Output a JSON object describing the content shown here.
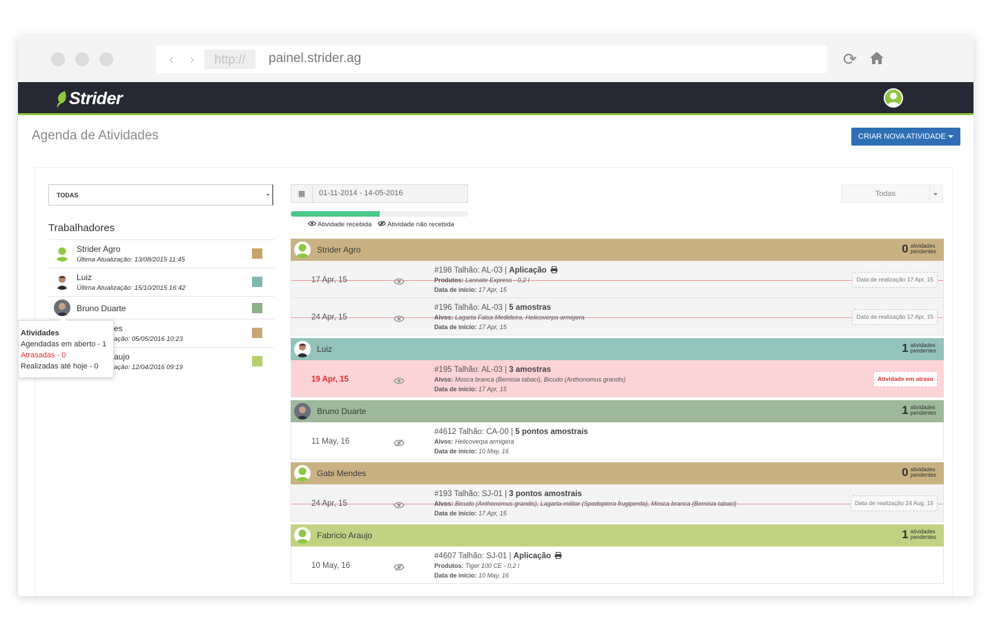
{
  "browser": {
    "protocol": "http://",
    "host": "painel.strider.ag",
    "nav_glyphs": "‹ ›",
    "reload_glyph": "⟳"
  },
  "app": {
    "brand": "Strider",
    "brand_color": "#8dc63f",
    "page_title": "Agenda de Atividades",
    "create_button": "CRIAR NOVA ATIVIDADE"
  },
  "sidebar": {
    "filter_value": "TODAS",
    "workers_title": "Trabalhadores",
    "workers": [
      {
        "name": "Strider Agro",
        "update": "Última Atualização: 13/08/2015 11:45",
        "color": "#c7a46a"
      },
      {
        "name": "Luiz",
        "update": "Última Atualização: 15/10/2015 16:42",
        "color": "#7fb8b0"
      },
      {
        "name": "Bruno Duarte",
        "update": "",
        "color": "#8fae8a"
      },
      {
        "name": "es",
        "update": "ação: 05/05/2016 10:23",
        "color": "#c9a57a"
      },
      {
        "name": "aujo",
        "update": "ação: 12/04/2016 09:19",
        "color": "#b5cf6b"
      }
    ],
    "tooltip": {
      "title": "Atividades",
      "line1": "Agendadas em aberto - 1",
      "line2": "Atrasadas - 0",
      "line3": "Realizadas até hoje - 0"
    }
  },
  "toolbar": {
    "calendar_glyph": "▦",
    "date_range": "01-11-2014 - 14-05-2016",
    "progress": 0.5,
    "legend_received": "Atividade recebida",
    "legend_not_received": "Atividade não recebida",
    "status_filter": "Todas"
  },
  "pending_label_1": "atividades",
  "pending_label_2": "pendentes",
  "groups": [
    {
      "name": "Strider Agro",
      "count": "0",
      "color": "#c9b183",
      "activities": [
        {
          "date": "17 Apr, 15",
          "title": "#198 Talhão: AL-03 |",
          "type": "Aplicação",
          "print": true,
          "l2_label": "Produtos:",
          "l2_value": "Lannate Express - 0,2 l",
          "l3_label": "Data de início:",
          "l3_value": "17 Apr, 15",
          "status": "Data de realização 17 Apr, 15",
          "style": "gray",
          "struck": true
        },
        {
          "date": "24 Apr, 15",
          "title": "#196 Talhão: AL-03 |",
          "type": "5 amostras",
          "print": false,
          "l2_label": "Alvos:",
          "l2_value": "Lagarta Falsa Medideira, Helicoverpa armigera",
          "l3_label": "Data de início:",
          "l3_value": "17 Apr, 15",
          "status": "Data de realização 17 Apr, 15",
          "style": "gray",
          "struck": true
        }
      ]
    },
    {
      "name": "Luiz",
      "count": "1",
      "color": "#94c3bc",
      "activities": [
        {
          "date": "19 Apr, 15",
          "title": "#195 Talhão: AL-03 |",
          "type": "3 amostras",
          "print": false,
          "l2_label": "Alvos:",
          "l2_value": "Mosca branca (Bemisia tabaci), Bicudo (Anthonomus grandis)",
          "l3_label": "Data de início:",
          "l3_value": "17 Apr, 15",
          "status": "Atividade em atraso",
          "style": "red",
          "struck": false
        }
      ]
    },
    {
      "name": "Bruno Duarte",
      "count": "1",
      "color": "#9db89a",
      "activities": [
        {
          "date": "11 May, 16",
          "title": "#4612 Talhão: CA-00 |",
          "type": "5 pontos amostrais",
          "print": false,
          "l2_label": "Alvos:",
          "l2_value": "Helicoverpa armigera",
          "l3_label": "Data de início:",
          "l3_value": "10 May, 16",
          "status": "",
          "style": "white",
          "struck": false
        }
      ]
    },
    {
      "name": "Gabi Mendes",
      "count": "0",
      "color": "#c9b183",
      "activities": [
        {
          "date": "24 Apr, 15",
          "title": "#193 Talhão: SJ-01 |",
          "type": "3 pontos amostrais",
          "print": false,
          "l2_label": "Alvos:",
          "l2_value": "Bicudo (Anthonomus grandis), Lagarta-militar (Spodoptera frugiperda), Mosca branca (Bemisia tabaci)",
          "l3_label": "Data de início:",
          "l3_value": "17 Apr, 15",
          "status": "Data de realização 24 Aug, 15",
          "style": "gray",
          "struck": true
        }
      ]
    },
    {
      "name": "Fabricio Araujo",
      "count": "1",
      "color": "#c1d282",
      "activities": [
        {
          "date": "10 May, 16",
          "title": "#4607 Talhão: SJ-01 |",
          "type": "Aplicação",
          "print": true,
          "l2_label": "Produtos:",
          "l2_value": "Tiger 100 CE - 0,2 l",
          "l3_label": "Data de início:",
          "l3_value": "10 May, 16",
          "status": "",
          "style": "white",
          "struck": false
        }
      ]
    }
  ]
}
